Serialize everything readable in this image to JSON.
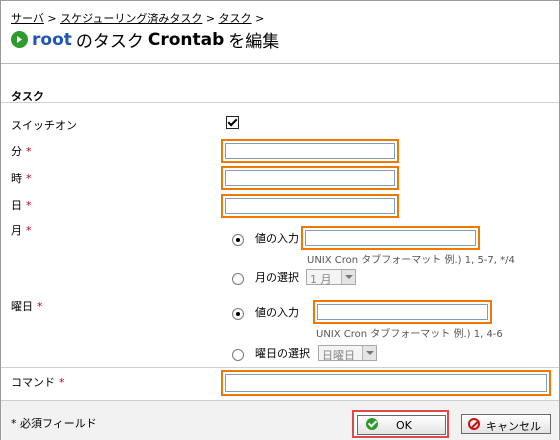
{
  "breadcrumb": {
    "items": [
      "サーバ",
      "スケジューリング済みタスク",
      "タスク"
    ],
    "separator": ">"
  },
  "title": {
    "user": "root",
    "prefix": "のタスク",
    "object": "Crontab",
    "suffix": "を編集"
  },
  "section_title": "タスク",
  "fields": {
    "switch_on": "スイッチオン",
    "minute": "分",
    "hour": "時",
    "day": "日",
    "month": "月",
    "weekday": "曜日",
    "command": "コマンド",
    "required_mark": "*"
  },
  "month": {
    "enter_value": "値の入力",
    "hint": "UNIX Cron タブフォーマット 例.) 1, 5-7, */4",
    "select_label": "月の選択",
    "select_value": "1 月"
  },
  "weekday": {
    "enter_value": "値の入力",
    "hint": "UNIX Cron タブフォーマット 例.) 1, 4-6",
    "select_label": "曜日の選択",
    "select_value": "日曜日"
  },
  "footer": {
    "required_note": "* 必須フィールド",
    "ok": "OK",
    "cancel": "キャンセル"
  },
  "colors": {
    "highlight": "#f07800",
    "ok_highlight": "#e0484a",
    "required": "#c00000",
    "user": "#1f55b8"
  },
  "icons": [
    "green-arrow-icon",
    "checkmark-icon",
    "cancel-icon",
    "chevron-down-icon"
  ]
}
